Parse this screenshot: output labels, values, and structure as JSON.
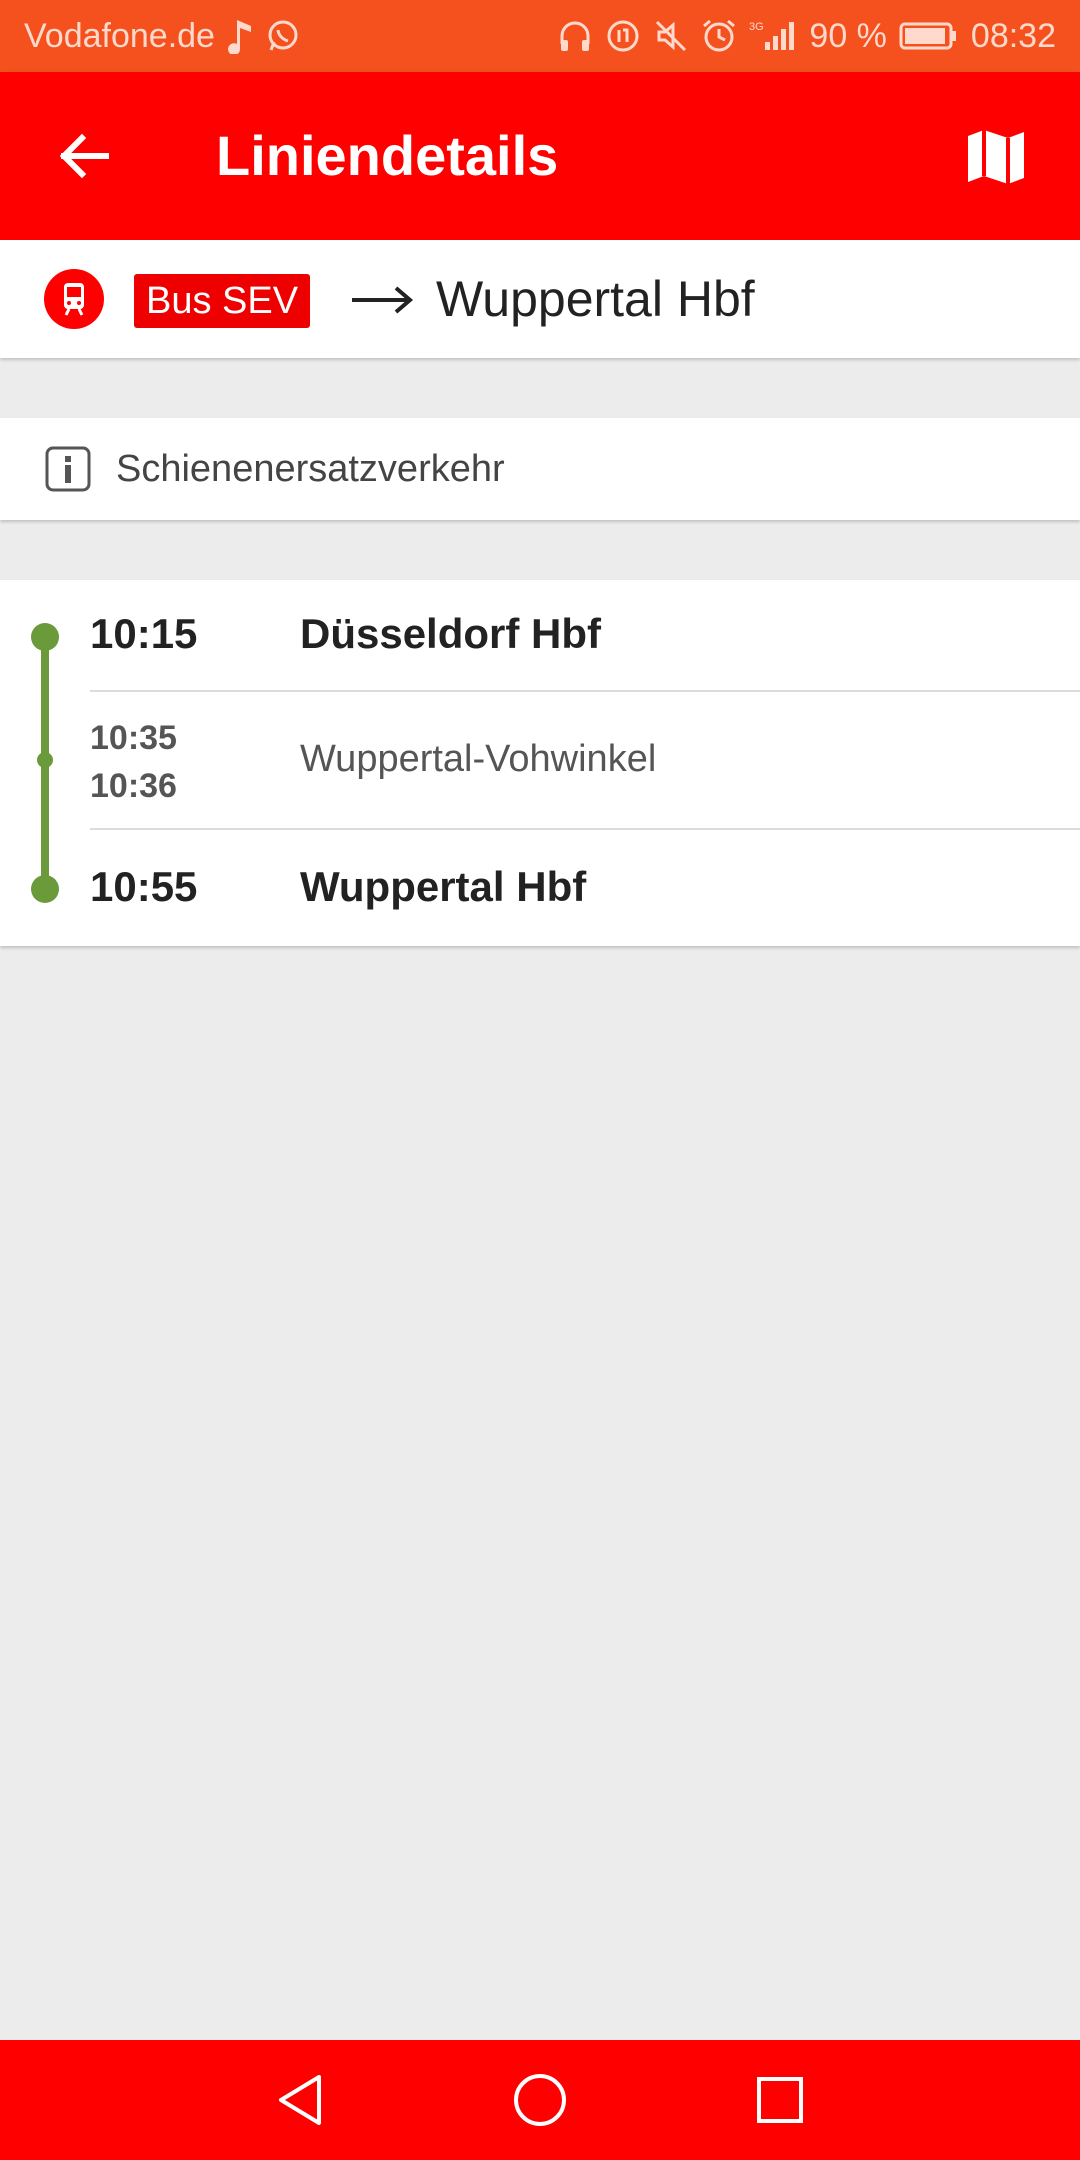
{
  "status_bar": {
    "carrier": "Vodafone.de",
    "network": "3G",
    "battery": "90 %",
    "time": "08:32",
    "icons_left": [
      "music-note-icon",
      "whatsapp-icon"
    ],
    "icons_right": [
      "headphones-icon",
      "data-saver-icon",
      "mute-icon",
      "alarm-icon",
      "signal-icon",
      "battery-icon"
    ]
  },
  "appbar": {
    "title": "Liniendetails",
    "back_icon": "arrow-left-icon",
    "map_icon": "map-icon"
  },
  "line": {
    "badge_icon": "train-icon",
    "label": "Bus SEV",
    "arrow_icon": "long-arrow-right-icon",
    "destination": "Wuppertal Hbf"
  },
  "info": {
    "icon": "info-icon",
    "text": "Schienenersatzverkehr"
  },
  "stops": [
    {
      "arrival": "10:15",
      "name": "Düsseldorf Hbf"
    },
    {
      "arrival": "10:35",
      "departure": "10:36",
      "name": "Wuppertal-Vohwinkel"
    },
    {
      "arrival": "10:55",
      "name": "Wuppertal Hbf"
    }
  ],
  "colors": {
    "status_bar": "#f4511e",
    "brand_red": "#ff0000",
    "route_green": "#6a9a3a",
    "background": "#ececec"
  },
  "navbar": {
    "buttons": [
      "back-triangle-icon",
      "home-circle-icon",
      "recents-square-icon"
    ]
  }
}
